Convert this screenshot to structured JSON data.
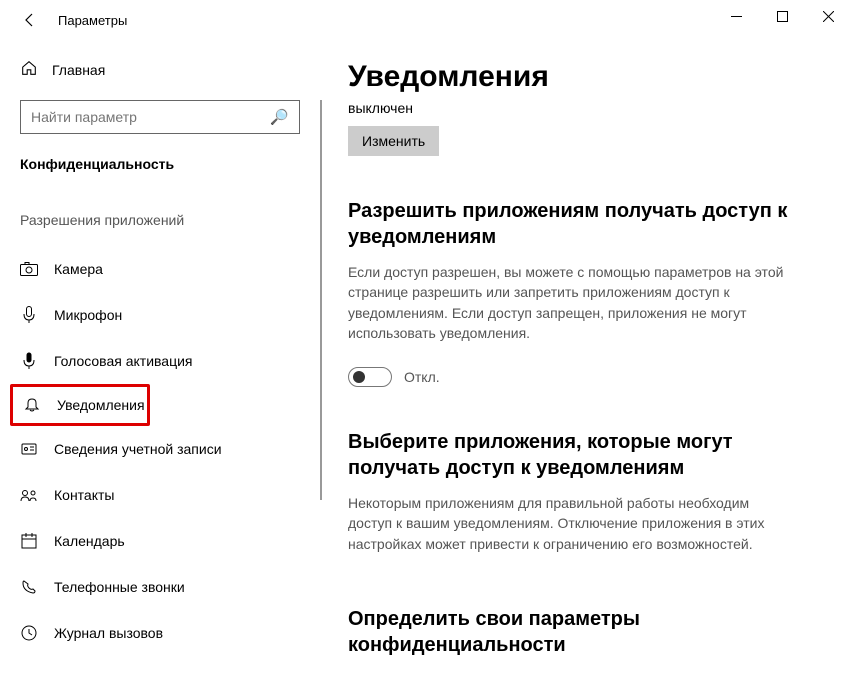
{
  "window": {
    "title": "Параметры"
  },
  "sidebar": {
    "home": "Главная",
    "search_placeholder": "Найти параметр",
    "category": "Конфиденциальность",
    "subhead": "Разрешения приложений",
    "items": [
      {
        "icon": "camera",
        "label": "Камера"
      },
      {
        "icon": "mic",
        "label": "Микрофон"
      },
      {
        "icon": "voice",
        "label": "Голосовая активация"
      },
      {
        "icon": "bell",
        "label": "Уведомления",
        "selected": true
      },
      {
        "icon": "account",
        "label": "Сведения учетной записи"
      },
      {
        "icon": "contacts",
        "label": "Контакты"
      },
      {
        "icon": "calendar",
        "label": "Календарь"
      },
      {
        "icon": "phone",
        "label": "Телефонные звонки"
      },
      {
        "icon": "history",
        "label": "Журнал вызовов"
      }
    ]
  },
  "main": {
    "title": "Уведомления",
    "status": "выключен",
    "change": "Изменить",
    "section1": {
      "heading": "Разрешить приложениям получать доступ к уведомлениям",
      "body": "Если доступ разрешен, вы можете с помощью параметров на этой странице разрешить или запретить приложениям доступ к уведомлениям. Если доступ запрещен, приложения не могут использовать уведомления.",
      "toggle_state": "Откл."
    },
    "section2": {
      "heading": "Выберите приложения, которые могут получать доступ к уведомлениям",
      "body": "Некоторым приложениям для правильной работы необходим доступ к вашим уведомлениям. Отключение приложения в этих настройках может привести к ограничению его возможностей."
    },
    "section3": {
      "heading": "Определить свои параметры конфиденциальности"
    }
  }
}
